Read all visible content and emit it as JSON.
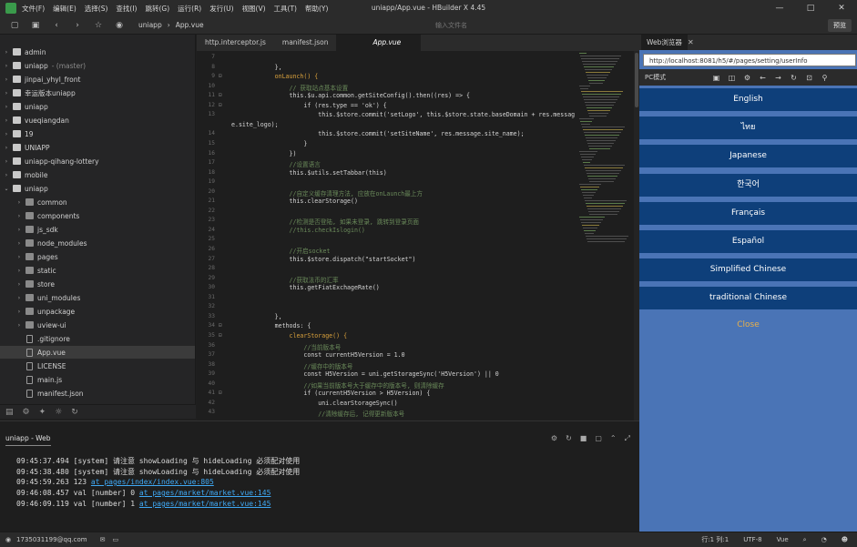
{
  "window": {
    "title": "uniapp/App.vue - HBuilder X 4.45",
    "menu": [
      "文件(F)",
      "编辑(E)",
      "选择(S)",
      "查找(I)",
      "跳转(G)",
      "运行(R)",
      "发行(U)",
      "视图(V)",
      "工具(T)",
      "帮助(Y)"
    ],
    "controls": [
      "—",
      "□",
      "✕"
    ]
  },
  "toolbar": {
    "breadcrumb": [
      "uniapp",
      "App.vue"
    ],
    "search_placeholder": "输入文件名",
    "preview_label": "预览"
  },
  "sidebar": {
    "items": [
      {
        "label": "admin",
        "type": "project",
        "arrow": "›"
      },
      {
        "label": "uniapp",
        "type": "project",
        "arrow": "›",
        "sub": "- (master)"
      },
      {
        "label": "jinpai_yhyl_front",
        "type": "project",
        "arrow": "›"
      },
      {
        "label": "幸运版本uniapp",
        "type": "project",
        "arrow": "›"
      },
      {
        "label": "uniapp",
        "type": "project",
        "arrow": "›"
      },
      {
        "label": "vueqiangdan",
        "type": "project",
        "arrow": "›"
      },
      {
        "label": "19",
        "type": "project",
        "arrow": "›"
      },
      {
        "label": "UNIAPP",
        "type": "project",
        "arrow": "›"
      },
      {
        "label": "uniapp-qihang-lottery",
        "type": "project",
        "arrow": "›"
      },
      {
        "label": "mobile",
        "type": "project",
        "arrow": "›"
      },
      {
        "label": "uniapp",
        "type": "project",
        "arrow": "⌄"
      },
      {
        "label": "common",
        "type": "folder",
        "arrow": "›"
      },
      {
        "label": "components",
        "type": "folder",
        "arrow": "›"
      },
      {
        "label": "js_sdk",
        "type": "folder",
        "arrow": "›"
      },
      {
        "label": "node_modules",
        "type": "folder",
        "arrow": "›"
      },
      {
        "label": "pages",
        "type": "folder",
        "arrow": "›"
      },
      {
        "label": "static",
        "type": "folder",
        "arrow": "›"
      },
      {
        "label": "store",
        "type": "folder",
        "arrow": "›"
      },
      {
        "label": "uni_modules",
        "type": "folder",
        "arrow": "›"
      },
      {
        "label": "unpackage",
        "type": "folder",
        "arrow": "›"
      },
      {
        "label": "uview-ui",
        "type": "folder",
        "arrow": "›"
      },
      {
        "label": ".gitignore",
        "type": "file",
        "arrow": ""
      },
      {
        "label": "App.vue",
        "type": "file",
        "arrow": "",
        "selected": true
      },
      {
        "label": "LICENSE",
        "type": "file",
        "arrow": ""
      },
      {
        "label": "main.js",
        "type": "file",
        "arrow": ""
      },
      {
        "label": "manifest.json",
        "type": "file",
        "arrow": ""
      }
    ]
  },
  "editor": {
    "tabs": [
      "http.interceptor.js",
      "manifest.json",
      "App.vue"
    ],
    "lines": [
      {
        "n": "7",
        "t": "",
        "c": ""
      },
      {
        "n": "8",
        "t": "            },",
        "c": ""
      },
      {
        "n": "9",
        "t": "            onLaunch() {",
        "c": "fn"
      },
      {
        "n": "10",
        "t": "                // 获取站点基本设置",
        "c": "comment"
      },
      {
        "n": "11",
        "t": "                this.$u.api.common.getSiteConfig().then((res) => {",
        "c": ""
      },
      {
        "n": "12",
        "t": "                    if (res.type == 'ok') {",
        "c": ""
      },
      {
        "n": "13",
        "t": "                        this.$store.commit('setLogo', this.$store.state.baseDomain + res.messag",
        "c": ""
      },
      {
        "n": "",
        "t": "e.site_logo);",
        "c": ""
      },
      {
        "n": "14",
        "t": "                        this.$store.commit('setSiteName', res.message.site_name);",
        "c": ""
      },
      {
        "n": "15",
        "t": "                    }",
        "c": ""
      },
      {
        "n": "16",
        "t": "                })",
        "c": ""
      },
      {
        "n": "17",
        "t": "                //设置语言",
        "c": "comment"
      },
      {
        "n": "18",
        "t": "                this.$utils.setTabbar(this)",
        "c": ""
      },
      {
        "n": "19",
        "t": "",
        "c": ""
      },
      {
        "n": "20",
        "t": "                //自定义缓存清理方法, 应放在onLaunch最上方",
        "c": "comment"
      },
      {
        "n": "21",
        "t": "                this.clearStorage()",
        "c": ""
      },
      {
        "n": "22",
        "t": "",
        "c": ""
      },
      {
        "n": "23",
        "t": "                //检测是否登陆, 如果未登录, 跳转到登录页面",
        "c": "comment"
      },
      {
        "n": "24",
        "t": "                //this.checkIslogin()",
        "c": "comment"
      },
      {
        "n": "25",
        "t": "",
        "c": ""
      },
      {
        "n": "26",
        "t": "                //开启socket",
        "c": "comment"
      },
      {
        "n": "27",
        "t": "                this.$store.dispatch(\"startSocket\")",
        "c": ""
      },
      {
        "n": "28",
        "t": "",
        "c": ""
      },
      {
        "n": "29",
        "t": "                //获取法币的汇率",
        "c": "comment"
      },
      {
        "n": "30",
        "t": "                this.getFiatExchageRate()",
        "c": ""
      },
      {
        "n": "31",
        "t": "",
        "c": ""
      },
      {
        "n": "32",
        "t": "",
        "c": ""
      },
      {
        "n": "33",
        "t": "            },",
        "c": ""
      },
      {
        "n": "34",
        "t": "            methods: {",
        "c": ""
      },
      {
        "n": "35",
        "t": "                clearStorage() {",
        "c": "fn"
      },
      {
        "n": "36",
        "t": "                    //当前版本号",
        "c": "comment"
      },
      {
        "n": "37",
        "t": "                    const currentH5Version = 1.0",
        "c": ""
      },
      {
        "n": "38",
        "t": "                    //缓存中的版本号",
        "c": "comment"
      },
      {
        "n": "39",
        "t": "                    const H5Version = uni.getStorageSync('H5Version') || 0",
        "c": ""
      },
      {
        "n": "40",
        "t": "                    //如果当前版本号大于缓存中的版本号, 则清除缓存",
        "c": "comment"
      },
      {
        "n": "41",
        "t": "                    if (currentH5Version > H5Version) {",
        "c": ""
      },
      {
        "n": "42",
        "t": "                        uni.clearStorageSync()",
        "c": ""
      },
      {
        "n": "43",
        "t": "                        //清除缓存后, 记得更新版本号",
        "c": "comment"
      }
    ]
  },
  "console": {
    "tab_label": "uniapp - Web",
    "logs": [
      {
        "time": "09:45:37.494",
        "text": "[system] 请注意 showLoading 与 hideLoading 必须配对使用",
        "link": ""
      },
      {
        "time": "09:45:38.480",
        "text": "[system] 请注意 showLoading 与 hideLoading 必须配对使用",
        "link": ""
      },
      {
        "time": "09:45:59.263",
        "text": "123",
        "link": "at pages/index/index.vue:805"
      },
      {
        "time": "09:46:08.457",
        "text": "val [number] 0",
        "link": "at pages/market/market.vue:145"
      },
      {
        "time": "09:46:09.119",
        "text": "val [number] 1",
        "link": "at pages/market/market.vue:145"
      }
    ]
  },
  "browser": {
    "tab_label": "Web浏览器",
    "url": "http://localhost:8081/h5/#/pages/setting/userInfo",
    "mode": "PC模式",
    "languages": [
      "English",
      "ไทย",
      "Japanese",
      "한국어",
      "Français",
      "Español",
      "Simplified Chinese",
      "traditional Chinese"
    ],
    "close_label": "Close",
    "colors": {
      "page_bg": "#4a74b6",
      "button_bg": "#0e3f7a",
      "close_text": "#e8b04a"
    }
  },
  "statusbar": {
    "user": "1735031199@qq.com",
    "position": "行:1  列:1",
    "encoding": "UTF-8",
    "language": "Vue"
  }
}
